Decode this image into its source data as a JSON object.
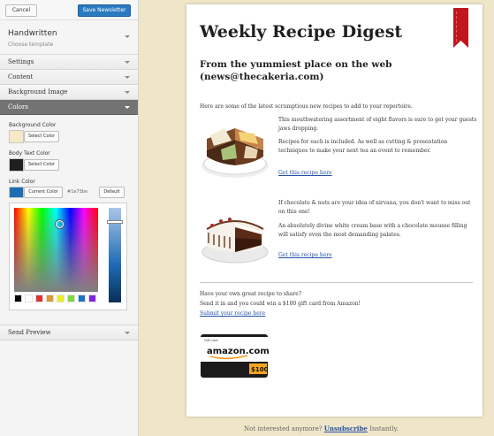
{
  "toolbar": {
    "cancel_label": "Cancel",
    "save_label": "Save Newsletter"
  },
  "theme": {
    "name": "Handwritten",
    "subtitle": "Choose template"
  },
  "sections": [
    "Settings",
    "Content",
    "Background Image",
    "Colors"
  ],
  "colors": {
    "background_label": "Background Color",
    "background_swatch": "#f6e9c6",
    "body_text_label": "Body Text Color",
    "body_text_swatch": "#1f1f1f",
    "link_label": "Link Color",
    "link_swatch": "#1e6cb4",
    "select_label": "Select Color",
    "current_label": "Current Color",
    "hex_value": "#1e73be",
    "default_label": "Default",
    "palette": [
      "#000000",
      "#ffffff",
      "#dd3333",
      "#dd9933",
      "#eeee22",
      "#81d742",
      "#1e73be",
      "#8224e3"
    ]
  },
  "send_preview": "Send Preview",
  "email": {
    "title": "Weekly Recipe Digest",
    "subtitle": "From the yummiest place on the web (news@thecakeria.com)",
    "intro": "Here are some of the latest scrumptious new recipes to add to your repertoire.",
    "recipe1": {
      "p1": "This mouthwatering assortment of eight flavors is sure to get your guests jaws dropping.",
      "p2": "Recipes for each is included. As well as cutting & presentation techniques to make your next tea an event to remember.",
      "link": "Get this recipe here"
    },
    "recipe2": {
      "p1": "If chocolate & nuts are your idea of nirvana, you don't want to miss out on this one!",
      "p2": "An absolutely divine white cream base with a chocolate mousse filling will satisfy even the most demanding palates.",
      "link": "Get this recipe here"
    },
    "share": {
      "line1": "Have your own great recipe to share?",
      "line2": "Send it in and you could win a $100 gift card from Amazon!",
      "link": "Submit your recipe here"
    },
    "giftcard": {
      "label": "Gift Card",
      "brand": "amazon.com",
      "amount": "$100"
    }
  },
  "footer": {
    "before": "Not interested anymore?",
    "link": "Unsubscribe",
    "after": "Instantly."
  }
}
